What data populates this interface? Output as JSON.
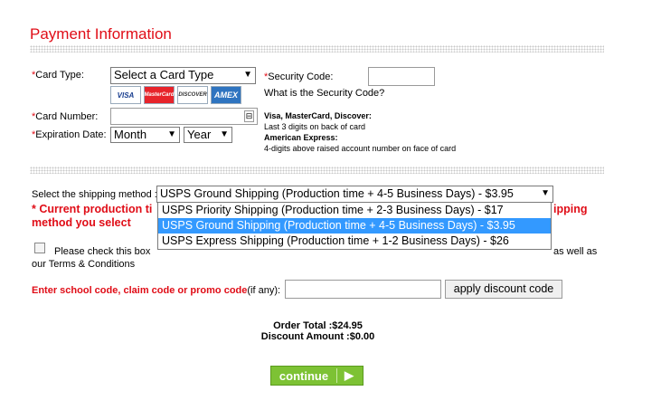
{
  "page": {
    "title": "Payment Information"
  },
  "card": {
    "type_label": "Card Type:",
    "type_value": "Select a Card Type",
    "logos": [
      "VISA",
      "MasterCard",
      "DISCOVER",
      "AMEX"
    ],
    "number_label": "Card Number:",
    "expiration_label": "Expiration Date:",
    "month_value": "Month",
    "year_value": "Year",
    "security_label": "Security Code:",
    "security_question": "What is the Security Code?",
    "help_brands1": "Visa, MasterCard, Discover:",
    "help_text1": "Last 3 digits on back of card",
    "help_brands2": "American Express:",
    "help_text2": "4-digits above raised account number on face of card"
  },
  "shipping": {
    "label": "Select the shipping method :",
    "selected": "USPS Ground Shipping (Production time + 4-5 Business Days) - $3.95",
    "options": [
      "USPS Priority Shipping (Production time + 2-3 Business Days) - $17",
      "USPS Ground Shipping (Production time + 4-5 Business Days) - $3.95",
      "USPS Express Shipping (Production time + 1-2 Business Days) - $26"
    ],
    "warning_line1_left": "* Current production ti",
    "warning_line1_right": "ipping",
    "warning_line2": "method you select",
    "terms_line1": "Please check this box",
    "terms_line1_rest": "as well as",
    "terms_line2": "our Terms & Conditions"
  },
  "promo": {
    "label": "Enter school code, claim code or promo code",
    "label_suffix": "(if any):",
    "button": "apply discount code"
  },
  "totals": {
    "order_total": "Order Total :$24.95",
    "discount": "Discount Amount :$0.00"
  },
  "continue_label": "continue"
}
